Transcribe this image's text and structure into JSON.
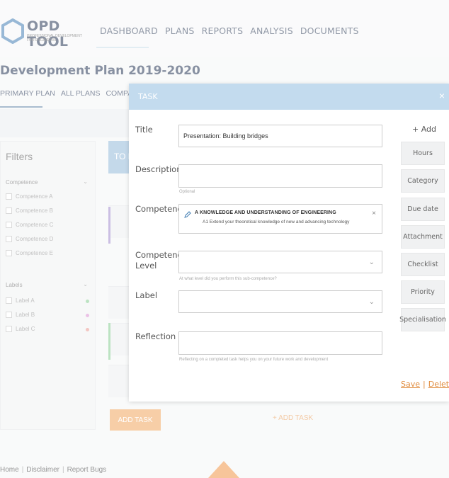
{
  "app": {
    "logo_title": "OPD TOOL",
    "logo_subtitle": "PROFESSIONAL DEVELOPMENT FOR ENGINEERS"
  },
  "nav": {
    "items": [
      "DASHBOARD",
      "PLANS",
      "REPORTS",
      "ANALYSIS",
      "DOCUMENTS"
    ]
  },
  "plan": {
    "title": "Development Plan 2019-2020",
    "tabs": [
      "PRIMARY PLAN",
      "ALL PLANS",
      "COMPANY PLAN"
    ]
  },
  "filters": {
    "title": "Filters",
    "competence_heading": "Competence",
    "competence_items": [
      "Competence A",
      "Competence B",
      "Competence C",
      "Competence D",
      "Competence E"
    ],
    "labels_heading": "Labels",
    "label_items": [
      {
        "name": "Label A",
        "color": "#7fc98a"
      },
      {
        "name": "Label B",
        "color": "#d98bd0"
      },
      {
        "name": "Label C",
        "color": "#e8938a"
      }
    ]
  },
  "board": {
    "column_head": "TO D",
    "add_task_button": "ADD TASK",
    "add_task_link": "+ ADD TASK",
    "bar_colors": [
      "#9b84c9",
      "#7fc98a"
    ]
  },
  "footer": {
    "links": [
      "Home",
      "Disclaimer",
      "Report Bugs"
    ],
    "separator": "|"
  },
  "modal": {
    "title": "TASK",
    "close": "×",
    "fields": {
      "title_label": "Title",
      "title_value": "Presentation: Building bridges",
      "description_label": "Description",
      "description_help": "Optional",
      "competence_label": "Competence",
      "competence_line1": "A   KNOWLEDGE AND UNDERSTANDING OF ENGINEERING",
      "competence_line2": "A1 Extend your theoretical knowledge of new and advancing technology",
      "competence_level_label": "Competence Level",
      "competence_level_help": "At what level did you perform this sub-competence?",
      "label_label": "Label",
      "reflection_label": "Reflection",
      "reflection_help": "Reflecting on a completed task helps you on your future work and development"
    },
    "side": {
      "add_label": "+ Add",
      "buttons": [
        "Hours",
        "Category",
        "Due date",
        "Attachment",
        "Checklist",
        "Priority",
        "Specialisation"
      ]
    },
    "actions": {
      "save": "Save",
      "separator": "|",
      "delete": "Delete"
    },
    "colors": {
      "header": "#c3dbee",
      "accent": "#e08b3d"
    }
  }
}
